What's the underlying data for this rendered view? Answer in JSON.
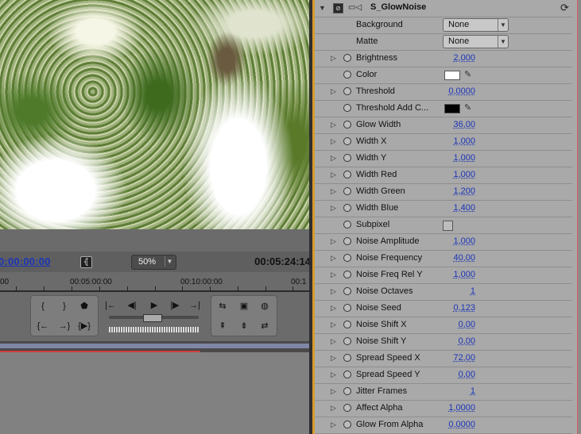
{
  "monitor": {
    "current_time": "0:00:00:00",
    "zoom": "50%",
    "duration": "00:05:24:14",
    "ruler_labels": [
      "00",
      "00:05:00:00",
      "00:10:00:00",
      "00:1"
    ],
    "transport_icons": [
      "mark-in",
      "mark-out",
      "set-marker",
      "step-back",
      "play",
      "step-forward",
      "go-to-in",
      "go-to-out",
      "play-in-out",
      "loop",
      "safe-margins",
      "output-settings",
      "lift",
      "extract",
      "trim"
    ]
  },
  "effect": {
    "name": "S_GlowNoise",
    "params": [
      {
        "name": "Background",
        "type": "select",
        "value": "None"
      },
      {
        "name": "Matte",
        "type": "select",
        "value": "None"
      },
      {
        "name": "Brightness",
        "type": "num",
        "value": "2,000",
        "expandable": true
      },
      {
        "name": "Color",
        "type": "color",
        "color": "#ffffff"
      },
      {
        "name": "Threshold",
        "type": "num",
        "value": "0,0000",
        "expandable": true
      },
      {
        "name": "Threshold Add C...",
        "type": "color",
        "color": "#000000"
      },
      {
        "name": "Glow Width",
        "type": "num",
        "value": "36,00",
        "expandable": true
      },
      {
        "name": "Width X",
        "type": "num",
        "value": "1,000",
        "expandable": true
      },
      {
        "name": "Width Y",
        "type": "num",
        "value": "1,000",
        "expandable": true
      },
      {
        "name": "Width Red",
        "type": "num",
        "value": "1,000",
        "expandable": true
      },
      {
        "name": "Width Green",
        "type": "num",
        "value": "1,200",
        "expandable": true
      },
      {
        "name": "Width Blue",
        "type": "num",
        "value": "1,400",
        "expandable": true
      },
      {
        "name": "Subpixel",
        "type": "check",
        "checked": false
      },
      {
        "name": "Noise Amplitude",
        "type": "num",
        "value": "1,000",
        "expandable": true
      },
      {
        "name": "Noise Frequency",
        "type": "num",
        "value": "40,00",
        "expandable": true
      },
      {
        "name": "Noise Freq Rel Y",
        "type": "num",
        "value": "1,000",
        "expandable": true
      },
      {
        "name": "Noise Octaves",
        "type": "num",
        "value": "1",
        "expandable": true
      },
      {
        "name": "Noise Seed",
        "type": "num",
        "value": "0,123",
        "expandable": true
      },
      {
        "name": "Noise Shift X",
        "type": "num",
        "value": "0,00",
        "expandable": true
      },
      {
        "name": "Noise Shift Y",
        "type": "num",
        "value": "0,00",
        "expandable": true
      },
      {
        "name": "Spread Speed X",
        "type": "num",
        "value": "72,00",
        "expandable": true
      },
      {
        "name": "Spread Speed Y",
        "type": "num",
        "value": "0,00",
        "expandable": true
      },
      {
        "name": "Jitter Frames",
        "type": "num",
        "value": "1",
        "expandable": true
      },
      {
        "name": "Affect Alpha",
        "type": "num",
        "value": "1,0000",
        "expandable": true
      },
      {
        "name": "Glow From Alpha",
        "type": "num",
        "value": "0,0000",
        "expandable": true
      }
    ]
  }
}
